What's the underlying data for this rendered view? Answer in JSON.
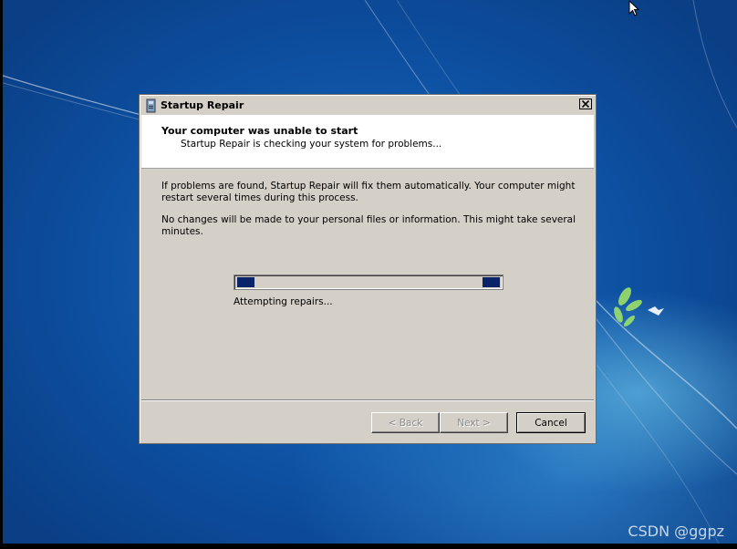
{
  "dialog": {
    "title": "Startup Repair",
    "close_icon": "close-icon",
    "app_icon": "startup-repair-icon",
    "header": {
      "title": "Your computer was unable to start",
      "subtitle": "Startup Repair is checking your system for problems..."
    },
    "body": {
      "paragraph1": "If problems are found, Startup Repair will fix them automatically. Your computer might restart several times during this process.",
      "paragraph2": "No changes will be made to your personal files or information. This might take several minutes."
    },
    "progress": {
      "style": "marquee",
      "status": "Attempting repairs..."
    },
    "buttons": {
      "back": "< Back",
      "next": "Next >",
      "cancel": "Cancel"
    }
  },
  "desktop": {
    "watermark": "CSDN @ggpz",
    "cursor_icon": "mouse-pointer-icon"
  },
  "colors": {
    "desktop_blue": "#0d4fa0",
    "dialog_face": "#d4d0c8",
    "progress_block": "#0a246a"
  }
}
